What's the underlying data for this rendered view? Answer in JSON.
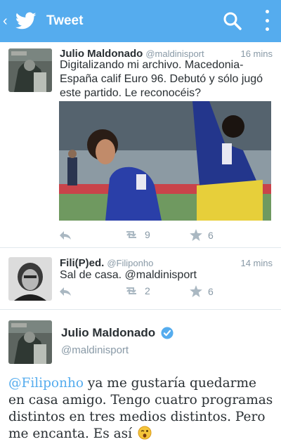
{
  "header": {
    "back_glyph": "‹",
    "title": "Tweet",
    "icons": [
      "twitter-bird-icon",
      "search-icon",
      "overflow-menu-icon"
    ],
    "color": "#55acee"
  },
  "tweets": [
    {
      "name": "Julio Maldonado",
      "handle": "@maldinisport",
      "time": "16 mins",
      "text": "Digitalizando mi archivo. Macedonia-España calif Euro 96. Debutó y sólo jugó este partido. Le reconocéis?",
      "retweets": "9",
      "favorites": "6"
    },
    {
      "name": "Fili(P)ed.",
      "handle": "@Filiponho",
      "time": "14 mins",
      "text": "Sal de casa.  @maldinisport",
      "retweets": "2",
      "favorites": "6"
    }
  ],
  "detail": {
    "name": "Julio Maldonado",
    "handle": "@maldinisport",
    "mention": "@Filiponho",
    "text": " ya me gustaría quedarme en casa amigo. Tengo cuatro programas distintos en tres medios distintos. Pero me encanta. Es así",
    "emoji": "wink-face-icon"
  }
}
